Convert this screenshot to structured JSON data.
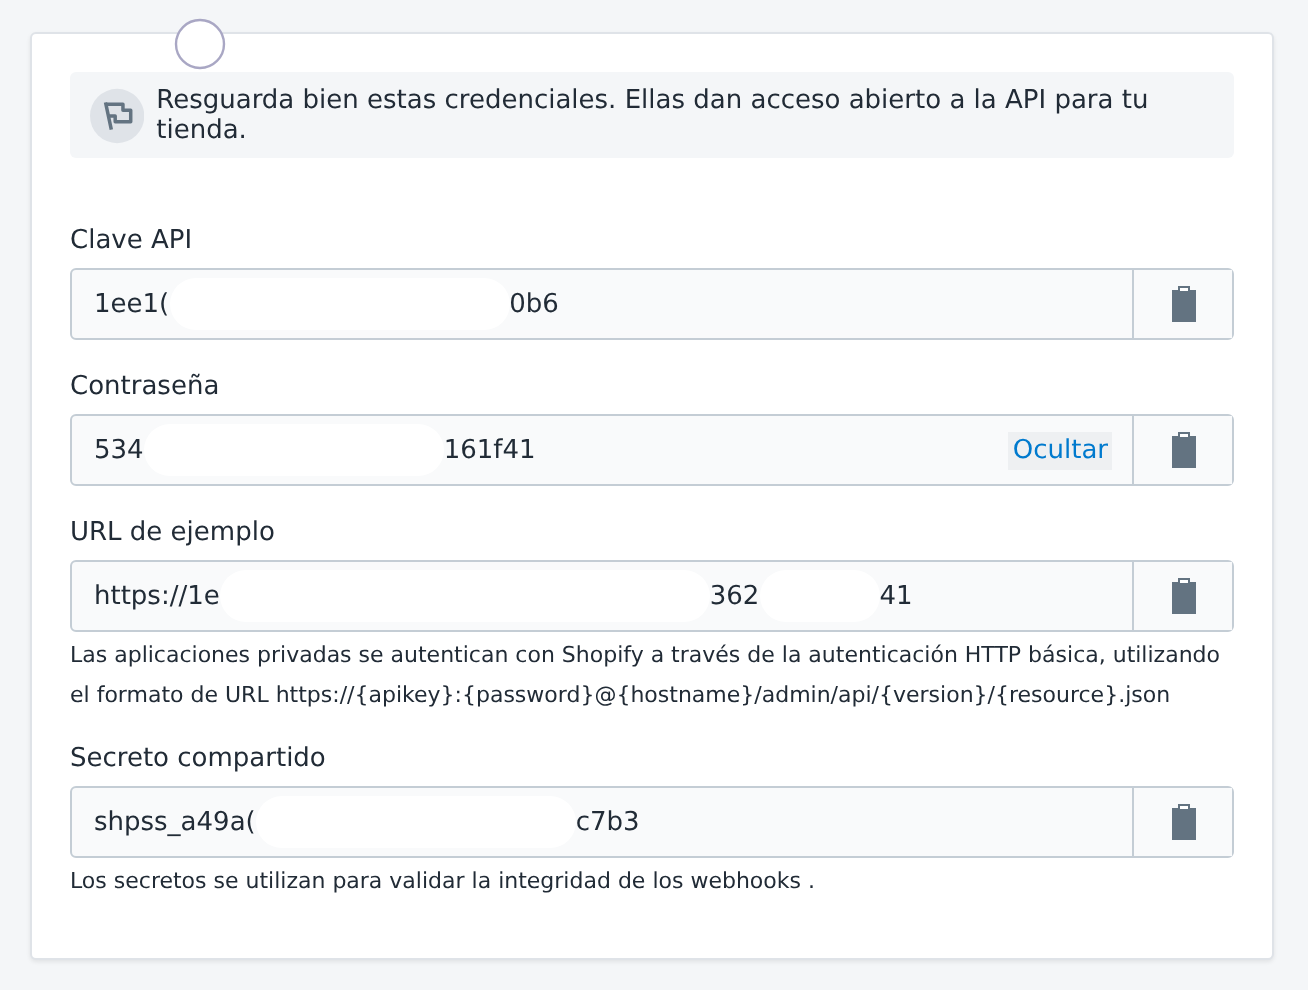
{
  "banner": {
    "text": "Resguarda bien estas credenciales. Ellas dan acceso abierto a la API para tu tienda."
  },
  "fields": [
    {
      "label": "Clave API",
      "segments": [
        "1ee1(",
        "0b6"
      ]
    },
    {
      "label": "Contraseña",
      "segments": [
        "534",
        "161f41"
      ],
      "toggle": "Ocultar"
    },
    {
      "label": "URL de ejemplo",
      "segments": [
        "https://1e",
        "362",
        "41"
      ],
      "help": "Las aplicaciones privadas se autentican con Shopify a través de la autenticación HTTP básica, utilizando el formato de URL https://{apikey}:{password}@{hostname}/admin/api/{version}/{resource}.json"
    },
    {
      "label": "Secreto compartido",
      "segments": [
        "shpss_a49a(",
        "c7b3"
      ],
      "help": "Los secretos se utilizan para validar la integridad de los webhooks ."
    }
  ]
}
